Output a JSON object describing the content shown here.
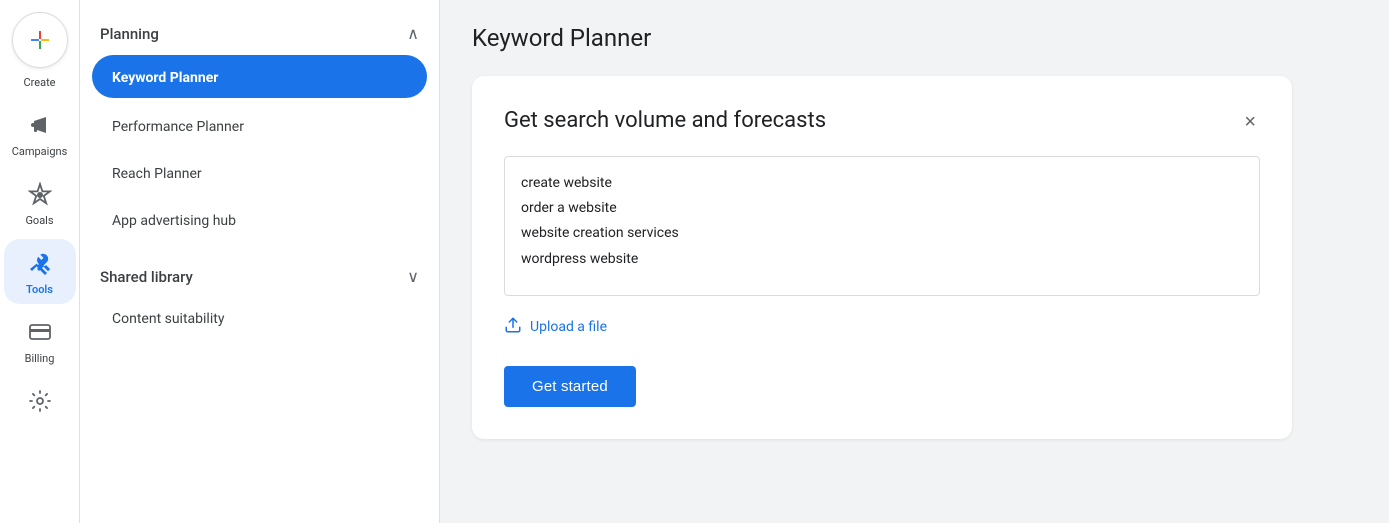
{
  "iconNav": {
    "createLabel": "Create",
    "items": [
      {
        "id": "campaigns",
        "label": "Campaigns",
        "icon": "📣",
        "active": false
      },
      {
        "id": "goals",
        "label": "Goals",
        "icon": "🏆",
        "active": false
      },
      {
        "id": "tools",
        "label": "Tools",
        "icon": "🔧",
        "active": true
      },
      {
        "id": "billing",
        "label": "Billing",
        "icon": "💳",
        "active": false
      },
      {
        "id": "settings",
        "label": "",
        "icon": "⚙️",
        "active": false
      }
    ]
  },
  "sidebar": {
    "planning": {
      "title": "Planning",
      "chevron": "∧",
      "items": [
        {
          "id": "keyword-planner",
          "label": "Keyword Planner",
          "active": true
        },
        {
          "id": "performance-planner",
          "label": "Performance Planner",
          "active": false
        },
        {
          "id": "reach-planner",
          "label": "Reach Planner",
          "active": false
        },
        {
          "id": "app-advertising-hub",
          "label": "App advertising hub",
          "active": false
        }
      ]
    },
    "sharedLibrary": {
      "title": "Shared library",
      "chevron": "∨",
      "items": [
        {
          "id": "content-suitability",
          "label": "Content suitability",
          "active": false
        }
      ]
    }
  },
  "pageTitle": "Keyword Planner",
  "card": {
    "title": "Get search volume and forecasts",
    "closeLabel": "×",
    "keywords": "create website\norder a website\nwebsite creation services\nwordpress website",
    "uploadLabel": "Upload a file",
    "getStartedLabel": "Get started"
  }
}
